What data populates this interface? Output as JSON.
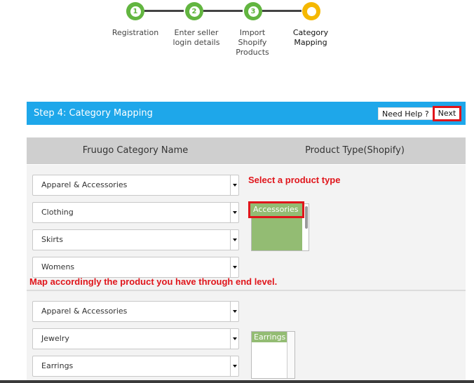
{
  "stepper": {
    "steps": [
      {
        "number": "1",
        "label": "Registration",
        "status": "completed"
      },
      {
        "number": "2",
        "label": "Enter seller login details",
        "status": "completed"
      },
      {
        "number": "3",
        "label": "Import Shopify Products",
        "status": "completed"
      },
      {
        "number": "",
        "label": "Category Mapping",
        "status": "current"
      }
    ]
  },
  "header": {
    "title": "Step 4: Category Mapping",
    "help_label": "Need Help ?",
    "next_label": "Next"
  },
  "table": {
    "col_left": "Fruugo Category Name",
    "col_right": "Product Type(Shopify)"
  },
  "rows": [
    {
      "categories": [
        "Apparel & Accessories",
        "Clothing",
        "Skirts",
        "Womens"
      ],
      "product_types": [
        "Accessories"
      ],
      "hint_select": "Select a product type",
      "hint_map": "Map accordingly the product you have through end level."
    },
    {
      "categories": [
        "Apparel & Accessories",
        "Jewelry",
        "Earrings"
      ],
      "product_types": [
        "Earrings"
      ]
    }
  ],
  "colors": {
    "header_blue": "#1ea7ea",
    "step_green": "#62b540",
    "step_current": "#f5b800",
    "highlight_red": "#e0151b",
    "selected_option": "#93bc73"
  }
}
